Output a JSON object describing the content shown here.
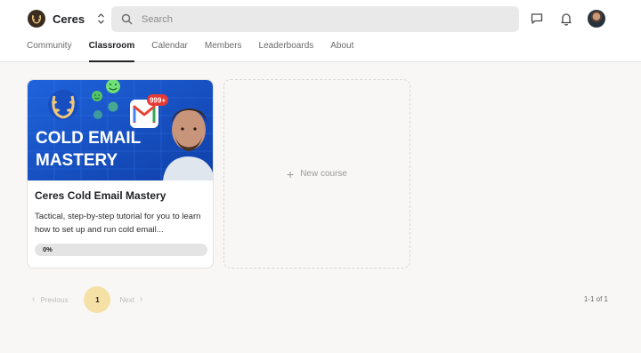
{
  "header": {
    "community_name": "Ceres",
    "search_placeholder": "Search"
  },
  "tabs": [
    {
      "label": "Community",
      "active": false
    },
    {
      "label": "Classroom",
      "active": true
    },
    {
      "label": "Calendar",
      "active": false
    },
    {
      "label": "Members",
      "active": false
    },
    {
      "label": "Leaderboards",
      "active": false
    },
    {
      "label": "About",
      "active": false
    }
  ],
  "course": {
    "thumbnail_text_line1": "COLD EMAIL",
    "thumbnail_text_line2": "MASTERY",
    "thumbnail_badge": "999+",
    "title": "Ceres Cold Email Mastery",
    "description": "Tactical, step-by-step tutorial for you to learn how to set up and run cold email...",
    "progress_percent": 0,
    "progress_label": "0%"
  },
  "new_course": {
    "label": "New course"
  },
  "pagination": {
    "previous_label": "Previous",
    "current_page": "1",
    "next_label": "Next",
    "count_label": "1-1 of 1"
  },
  "colors": {
    "accent_yellow": "#f5e1a6",
    "thumbnail_blue": "#1c5fd6",
    "badge_red": "#e53935"
  }
}
